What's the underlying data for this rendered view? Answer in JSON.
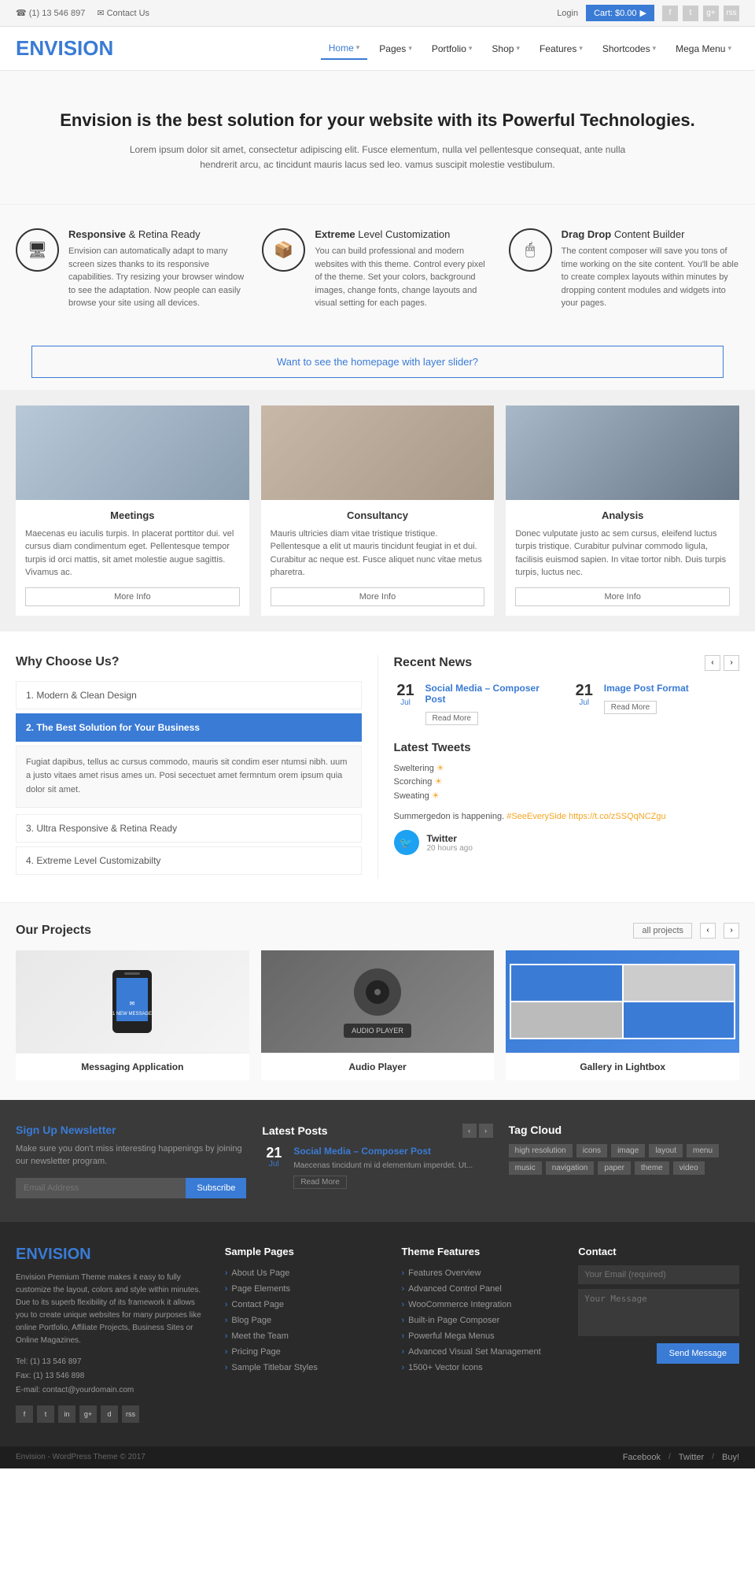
{
  "topbar": {
    "phone": "(1) 13 546 897",
    "contact": "Contact Us",
    "login": "Login",
    "cart": "Cart: $0.00"
  },
  "nav": {
    "logo_en": "EN",
    "logo_vision": "VISION",
    "items": [
      {
        "label": "Home",
        "active": true
      },
      {
        "label": "Pages"
      },
      {
        "label": "Portfolio"
      },
      {
        "label": "Shop"
      },
      {
        "label": "Features"
      },
      {
        "label": "Shortcodes"
      },
      {
        "label": "Mega Menu"
      }
    ]
  },
  "hero": {
    "title": "Envision is the best solution for your website with its Powerful Technologies.",
    "description": "Lorem ipsum dolor sit amet, consectetur adipiscing elit. Fusce elementum, nulla vel pellentesque consequat, ante nulla hendrerit arcu, ac tincidunt mauris lacus sed leo. vamus suscipit molestie vestibulum."
  },
  "features": [
    {
      "icon": "🖥",
      "title_bold": "Responsive",
      "title_rest": " & Retina Ready",
      "description": "Envision can automatically adapt to many screen sizes thanks to its responsive capabilities. Try resizing your browser window to see the adaptation. Now people can easily browse your site using all devices."
    },
    {
      "icon": "📦",
      "title_bold": "Extreme",
      "title_rest": " Level Customization",
      "description": "You can build professional and modern websites with this theme. Control every pixel of the theme. Set your colors, background images, change fonts, change layouts and visual setting for each pages."
    },
    {
      "icon": "🖱",
      "title_bold": "Drag Drop",
      "title_rest": " Content Builder",
      "description": "The content composer will save you tons of time working on the site content. You'll be able to create complex layouts within minutes by dropping content modules and widgets into your pages."
    }
  ],
  "slider_cta": {
    "text": "Want to see the homepage with layer slider?"
  },
  "services": [
    {
      "title": "Meetings",
      "description": "Maecenas eu iaculis turpis. In placerat porttitor dui. vel cursus diam condimentum eget. Pellentesque tempor turpis id orci mattis, sit amet molestie augue sagittis. Vivamus ac.",
      "btn": "More Info"
    },
    {
      "title": "Consultancy",
      "description": "Mauris ultricies diam vitae tristique tristique. Pellentesque a elit ut mauris tincidunt feugiat in et dui. Curabitur ac neque est. Fusce aliquet nunc vitae metus pharetra.",
      "btn": "More Info"
    },
    {
      "title": "Analysis",
      "description": "Donec vulputate justo ac sem cursus, eleifend luctus turpis tristique. Curabitur pulvinar commodo ligula, facilisis euismod sapien. In vitae tortor nibh. Duis turpis turpis, luctus nec.",
      "btn": "More Info"
    }
  ],
  "why": {
    "title": "Why Choose Us?",
    "items": [
      {
        "label": "1. Modern & Clean Design",
        "active": false
      },
      {
        "label": "2. The Best Solution for Your Business",
        "active": true
      },
      {
        "label": "3. Ultra Responsive & Retina Ready",
        "active": false
      },
      {
        "label": "4. Extreme Level Customizabilty",
        "active": false
      }
    ],
    "active_content": "Fugiat dapibus, tellus ac cursus commodo, mauris sit condim eser ntumsi nibh. uum a justo vitaes amet risus ames un. Posi secectuet amet fermntum orem ipsum quia dolor sit amet."
  },
  "recent_news": {
    "title": "Recent News",
    "items": [
      {
        "day": "21",
        "month": "Jul",
        "title": "Social Media – Composer Post",
        "read_more": "Read More"
      },
      {
        "day": "21",
        "month": "Jul",
        "title": "Image Post Format",
        "read_more": "Read More"
      }
    ]
  },
  "tweets": {
    "title": "Latest Tweets",
    "content": "Sweltering 🌞\nScorching 🌞\nSweating 🌞",
    "message": "Summergedon is happening. #SeeEverySide https://t.co/zSSQqNCZgu",
    "source": "Twitter",
    "time": "20 hours ago"
  },
  "projects": {
    "title": "Our Projects",
    "all_btn": "all projects",
    "items": [
      {
        "title": "Messaging Application"
      },
      {
        "title": "Audio Player"
      },
      {
        "title": "Gallery in Lightbox"
      }
    ]
  },
  "newsletter": {
    "title_normal": "Sign Up",
    "title_accent": " Newsletter",
    "description": "Make sure you don't miss interesting happenings by joining our newsletter program.",
    "placeholder": "Email Address",
    "btn": "Subscribe"
  },
  "latest_posts": {
    "title": "Latest Posts",
    "items": [
      {
        "day": "21",
        "month": "Jul",
        "title": "Social Media – Composer Post",
        "description": "Maecenas tincidunt mi id elementum imperdet. Ut...",
        "read_more": "Read More"
      }
    ]
  },
  "tag_cloud": {
    "title": "Tag Cloud",
    "tags": [
      "high resolution",
      "icons",
      "image",
      "layout",
      "menu",
      "music",
      "navigation",
      "paper",
      "theme",
      "video"
    ]
  },
  "footer_about": {
    "logo_en": "EN",
    "logo_vision": "VISION",
    "description": "Envision Premium Theme makes it easy to fully customize the layout, colors and style within minutes. Due to its superb flexibility of its framework it allows you to create unique websites for many purposes like online Portfolio, Affiliate Projects, Business Sites or Online Magazines.",
    "tel": "Tel: (1) 13 546 897",
    "fax": "Fax: (1) 13 546 898",
    "email": "E-mail: contact@yourdomain.com"
  },
  "footer_pages": {
    "title": "Sample Pages",
    "items": [
      "About Us Page",
      "Page Elements",
      "Contact Page",
      "Blog Page",
      "Meet the Team",
      "Pricing Page",
      "Sample Titlebar Styles"
    ]
  },
  "footer_features": {
    "title": "Theme Features",
    "items": [
      "Features Overview",
      "Advanced Control Panel",
      "WooCommerce Integration",
      "Built-in Page Composer",
      "Powerful Mega Menus",
      "Advanced Visual Set Management",
      "1500+ Vector Icons"
    ]
  },
  "footer_contact": {
    "title": "Contact",
    "email_placeholder": "Your Email (required)",
    "message_placeholder": "Your Message",
    "btn": "Send Message"
  },
  "footer_bottom": {
    "copyright": "Envision - WordPress Theme © 2017",
    "links": [
      "Facebook",
      "Twitter",
      "Buy!"
    ]
  }
}
